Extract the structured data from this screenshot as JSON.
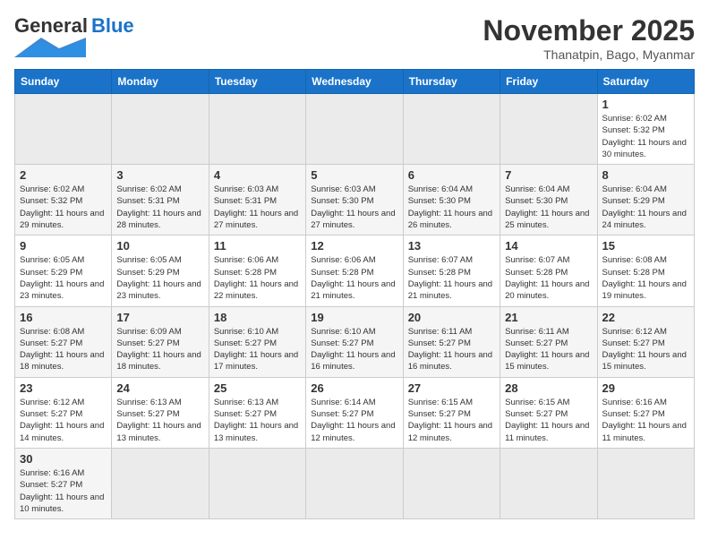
{
  "header": {
    "logo_general": "General",
    "logo_blue": "Blue",
    "month_title": "November 2025",
    "subtitle": "Thanatpin, Bago, Myanmar"
  },
  "days_of_week": [
    "Sunday",
    "Monday",
    "Tuesday",
    "Wednesday",
    "Thursday",
    "Friday",
    "Saturday"
  ],
  "weeks": [
    [
      null,
      null,
      null,
      null,
      null,
      null,
      {
        "day": "1",
        "sunrise": "6:02 AM",
        "sunset": "5:32 PM",
        "daylight": "11 hours and 30 minutes."
      }
    ],
    [
      {
        "day": "2",
        "sunrise": "6:02 AM",
        "sunset": "5:32 PM",
        "daylight": "11 hours and 29 minutes."
      },
      {
        "day": "3",
        "sunrise": "6:02 AM",
        "sunset": "5:31 PM",
        "daylight": "11 hours and 28 minutes."
      },
      {
        "day": "4",
        "sunrise": "6:03 AM",
        "sunset": "5:31 PM",
        "daylight": "11 hours and 27 minutes."
      },
      {
        "day": "5",
        "sunrise": "6:03 AM",
        "sunset": "5:30 PM",
        "daylight": "11 hours and 27 minutes."
      },
      {
        "day": "6",
        "sunrise": "6:04 AM",
        "sunset": "5:30 PM",
        "daylight": "11 hours and 26 minutes."
      },
      {
        "day": "7",
        "sunrise": "6:04 AM",
        "sunset": "5:30 PM",
        "daylight": "11 hours and 25 minutes."
      },
      {
        "day": "8",
        "sunrise": "6:04 AM",
        "sunset": "5:29 PM",
        "daylight": "11 hours and 24 minutes."
      }
    ],
    [
      {
        "day": "9",
        "sunrise": "6:05 AM",
        "sunset": "5:29 PM",
        "daylight": "11 hours and 23 minutes."
      },
      {
        "day": "10",
        "sunrise": "6:05 AM",
        "sunset": "5:29 PM",
        "daylight": "11 hours and 23 minutes."
      },
      {
        "day": "11",
        "sunrise": "6:06 AM",
        "sunset": "5:28 PM",
        "daylight": "11 hours and 22 minutes."
      },
      {
        "day": "12",
        "sunrise": "6:06 AM",
        "sunset": "5:28 PM",
        "daylight": "11 hours and 21 minutes."
      },
      {
        "day": "13",
        "sunrise": "6:07 AM",
        "sunset": "5:28 PM",
        "daylight": "11 hours and 21 minutes."
      },
      {
        "day": "14",
        "sunrise": "6:07 AM",
        "sunset": "5:28 PM",
        "daylight": "11 hours and 20 minutes."
      },
      {
        "day": "15",
        "sunrise": "6:08 AM",
        "sunset": "5:28 PM",
        "daylight": "11 hours and 19 minutes."
      }
    ],
    [
      {
        "day": "16",
        "sunrise": "6:08 AM",
        "sunset": "5:27 PM",
        "daylight": "11 hours and 18 minutes."
      },
      {
        "day": "17",
        "sunrise": "6:09 AM",
        "sunset": "5:27 PM",
        "daylight": "11 hours and 18 minutes."
      },
      {
        "day": "18",
        "sunrise": "6:10 AM",
        "sunset": "5:27 PM",
        "daylight": "11 hours and 17 minutes."
      },
      {
        "day": "19",
        "sunrise": "6:10 AM",
        "sunset": "5:27 PM",
        "daylight": "11 hours and 16 minutes."
      },
      {
        "day": "20",
        "sunrise": "6:11 AM",
        "sunset": "5:27 PM",
        "daylight": "11 hours and 16 minutes."
      },
      {
        "day": "21",
        "sunrise": "6:11 AM",
        "sunset": "5:27 PM",
        "daylight": "11 hours and 15 minutes."
      },
      {
        "day": "22",
        "sunrise": "6:12 AM",
        "sunset": "5:27 PM",
        "daylight": "11 hours and 15 minutes."
      }
    ],
    [
      {
        "day": "23",
        "sunrise": "6:12 AM",
        "sunset": "5:27 PM",
        "daylight": "11 hours and 14 minutes."
      },
      {
        "day": "24",
        "sunrise": "6:13 AM",
        "sunset": "5:27 PM",
        "daylight": "11 hours and 13 minutes."
      },
      {
        "day": "25",
        "sunrise": "6:13 AM",
        "sunset": "5:27 PM",
        "daylight": "11 hours and 13 minutes."
      },
      {
        "day": "26",
        "sunrise": "6:14 AM",
        "sunset": "5:27 PM",
        "daylight": "11 hours and 12 minutes."
      },
      {
        "day": "27",
        "sunrise": "6:15 AM",
        "sunset": "5:27 PM",
        "daylight": "11 hours and 12 minutes."
      },
      {
        "day": "28",
        "sunrise": "6:15 AM",
        "sunset": "5:27 PM",
        "daylight": "11 hours and 11 minutes."
      },
      {
        "day": "29",
        "sunrise": "6:16 AM",
        "sunset": "5:27 PM",
        "daylight": "11 hours and 11 minutes."
      }
    ],
    [
      {
        "day": "30",
        "sunrise": "6:16 AM",
        "sunset": "5:27 PM",
        "daylight": "11 hours and 10 minutes."
      },
      null,
      null,
      null,
      null,
      null,
      null
    ]
  ]
}
